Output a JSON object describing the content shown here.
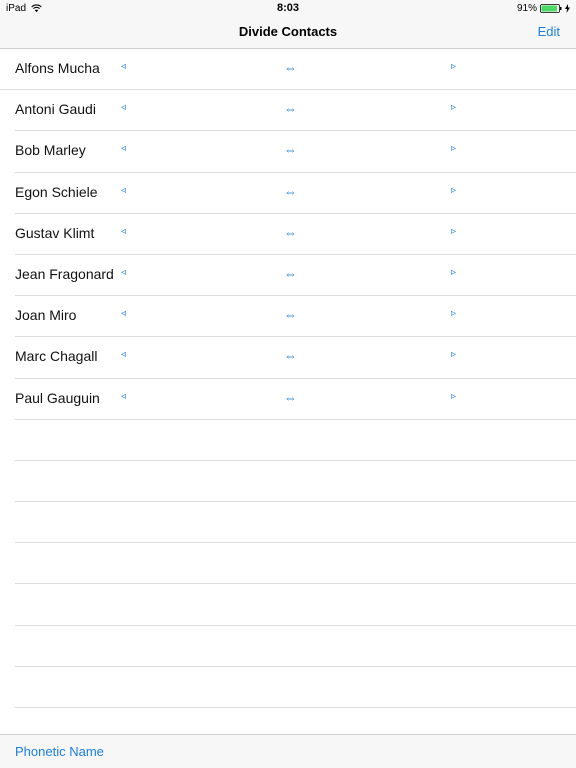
{
  "status_bar": {
    "device": "iPad",
    "time": "8:03",
    "battery_percent": "91%",
    "battery_level": 0.91,
    "wifi_icon": "wifi-icon",
    "charging_icon": "bolt-icon"
  },
  "nav": {
    "title": "Divide Contacts",
    "edit_label": "Edit"
  },
  "arrows": {
    "left": "◃",
    "swap": "⇔",
    "right": "▹"
  },
  "contacts": [
    {
      "name": "Alfons Mucha"
    },
    {
      "name": "Antoni Gaudi"
    },
    {
      "name": "Bob Marley"
    },
    {
      "name": "Egon Schiele"
    },
    {
      "name": "Gustav Klimt"
    },
    {
      "name": "Jean Fragonard"
    },
    {
      "name": "Joan Miro"
    },
    {
      "name": "Marc Chagall"
    },
    {
      "name": "Paul Gauguin"
    }
  ],
  "empty_rows": 8,
  "toolbar": {
    "phonetic_label": "Phonetic Name"
  },
  "colors": {
    "accent": "#1a7fe2",
    "bar_background": "#f7f7f7",
    "separator": "#dcdcde",
    "battery": "#4cd964"
  }
}
